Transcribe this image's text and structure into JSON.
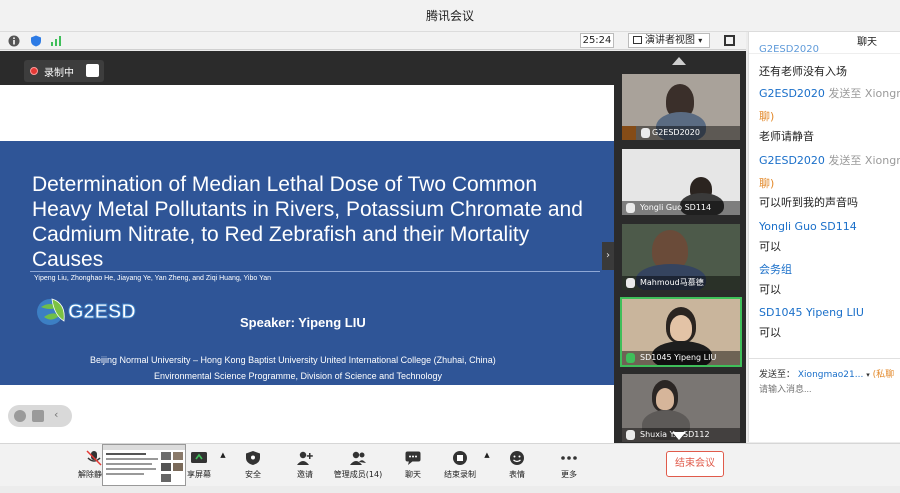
{
  "window": {
    "title": "腾讯会议"
  },
  "toolbar": {
    "timer": "25:24",
    "view_mode": "演讲者视图"
  },
  "recording": {
    "label": "录制中"
  },
  "slide": {
    "title": "Determination of Median Lethal Dose of Two Common Heavy Metal Pollutants in Rivers, Potassium Chromate and Cadmium Nitrate, to Red Zebrafish and their Mortality Causes",
    "authors": "Yipeng Liu, Zhonghao He, Jiayang Ye, Yan Zheng, and Ziqi Huang, Yibo Yan",
    "logo_text": "G2ESD",
    "speaker": "Speaker: Yipeng LIU",
    "affiliation_line1": "Beijing Normal University – Hong Kong Baptist University United International College (Zhuhai, China)",
    "affiliation_line2": "Environmental Science Programme, Division of Science and Technology"
  },
  "videos": [
    {
      "name": "G2ESD2020",
      "mic": "muted",
      "host": true
    },
    {
      "name": "Yongli Guo SD114",
      "mic": "muted",
      "host": false
    },
    {
      "name": "Mahmoud马慕德",
      "mic": "muted",
      "host": false
    },
    {
      "name": "SD1045 Yipeng LIU",
      "mic": "speaking",
      "host": false
    },
    {
      "name": "Shuxia Y... SD112",
      "mic": "muted",
      "host": false
    }
  ],
  "chat": {
    "header": "聊天",
    "messages": [
      {
        "text_top": "G2ESD2020",
        "text": "还有老师没有入场"
      },
      {
        "sender": "G2ESD2020",
        "extra": "发送至 Xiongm",
        "private": "聊)",
        "text": "老师请静音"
      },
      {
        "sender": "G2ESD2020",
        "extra": "发送至 Xiongm",
        "private": "聊)",
        "text": "可以听到我的声音吗"
      },
      {
        "sender": "Yongli Guo SD114",
        "text": "可以"
      },
      {
        "sender": "会务组",
        "text": "可以"
      },
      {
        "sender": "SD1045 Yipeng LIU",
        "text": "可以"
      }
    ],
    "send_to_label": "发送至：",
    "send_to_target": "Xiongmao21...",
    "send_to_private": "(私聊",
    "input_placeholder": "请输入消息..."
  },
  "bottombar": {
    "unmute": "解除静音",
    "share": "享屏幕",
    "security": "安全",
    "invite": "邀请",
    "members": "管理成员(14)",
    "chat": "聊天",
    "end_record": "结束录制",
    "reactions": "表情",
    "more": "更多",
    "end_meeting": "结束会议"
  },
  "colors": {
    "slide_blue": "#2f5597",
    "accent_green": "#3fbf5a",
    "end_red": "#e05b4b",
    "link_blue": "#1a6fc9"
  }
}
